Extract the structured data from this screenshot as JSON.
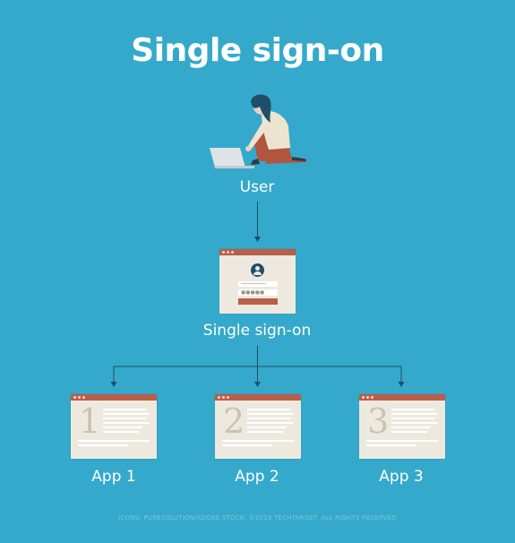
{
  "title": "Single sign-on",
  "nodes": {
    "user": "User",
    "sso": "Single sign-on",
    "apps": [
      {
        "label": "App 1",
        "number": "1"
      },
      {
        "label": "App 2",
        "number": "2"
      },
      {
        "label": "App 3",
        "number": "3"
      }
    ]
  },
  "login_form": {
    "password_mask": "●●●●●"
  },
  "footer": "ICONS: PURESOLUTION/ADOBE STOCK; ©2019 TECHTARGET. ALL RIGHTS RESERVED",
  "colors": {
    "background": "#35a9cb",
    "window": "#eee9df",
    "window_bar": "#b95e4a",
    "arrow": "#1f4e6b"
  }
}
